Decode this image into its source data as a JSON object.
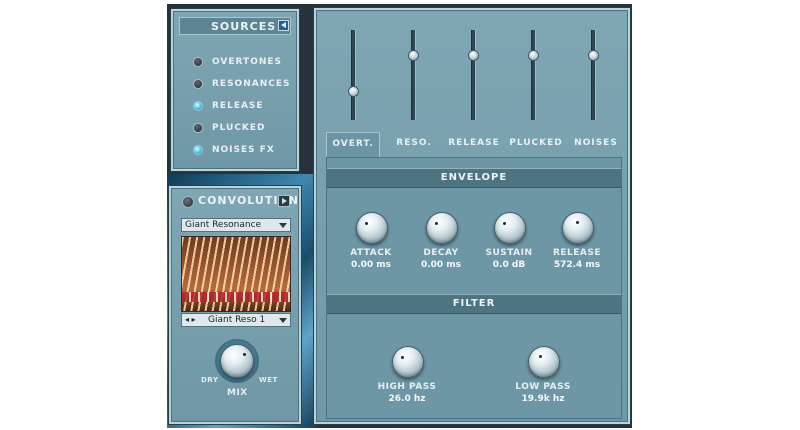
{
  "sources": {
    "title": "SOURCES",
    "items": [
      {
        "label": "OVERTONES",
        "on": false
      },
      {
        "label": "RESONANCES",
        "on": false
      },
      {
        "label": "RELEASE",
        "on": true
      },
      {
        "label": "PLUCKED",
        "on": false
      },
      {
        "label": "NOISES FX",
        "on": true
      }
    ]
  },
  "convolution": {
    "title": "CONVOLUTION",
    "preset": "Giant Resonance",
    "ir_name": "Giant Reso 1",
    "mix": {
      "label": "MIX",
      "dry": "DRY",
      "wet": "WET"
    }
  },
  "tabs": [
    "OVERT.",
    "RESO.",
    "RELEASE",
    "PLUCKED",
    "NOISES"
  ],
  "active_tab": "OVERT.",
  "envelope": {
    "title": "ENVELOPE",
    "knobs": [
      {
        "label": "ATTACK",
        "value": "0.00 ms"
      },
      {
        "label": "DECAY",
        "value": "0.00 ms"
      },
      {
        "label": "SUSTAIN",
        "value": "0.0 dB"
      },
      {
        "label": "RELEASE",
        "value": "572.4 ms"
      }
    ]
  },
  "filter": {
    "title": "FILTER",
    "knobs": [
      {
        "label": "HIGH PASS",
        "value": "26.0 hz"
      },
      {
        "label": "LOW PASS",
        "value": "19.9k hz"
      }
    ]
  },
  "colors": {
    "panel": "#7fa6b3",
    "led_on": "#3fc4f0",
    "frame": "#28323a"
  }
}
